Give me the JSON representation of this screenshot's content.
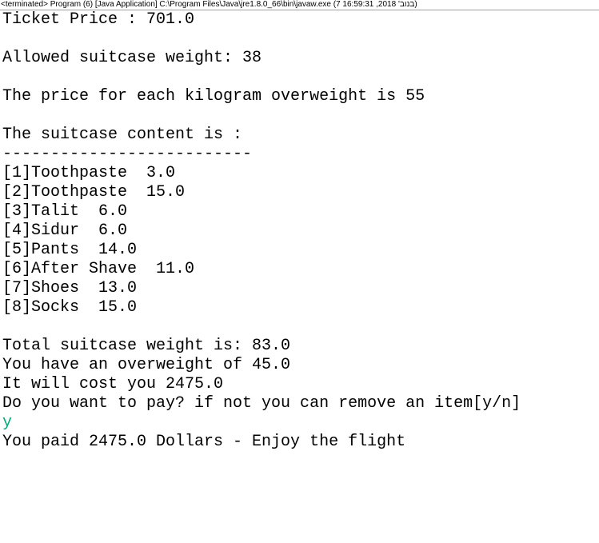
{
  "header": {
    "title": "<terminated> Program (6) [Java Application] C:\\Program Files\\Java\\jre1.8.0_66\\bin\\javaw.exe (7 16:59:31 ,2018 'בנוב)"
  },
  "colors": {
    "stdout": "#000000",
    "stdin": "#00a87a",
    "background": "#ffffff"
  },
  "console": {
    "lines": [
      {
        "text": "Ticket Price : 701.0",
        "kind": "output"
      },
      {
        "text": "",
        "kind": "output"
      },
      {
        "text": "Allowed suitcase weight: 38",
        "kind": "output"
      },
      {
        "text": "",
        "kind": "output"
      },
      {
        "text": "The price for each kilogram overweight is 55",
        "kind": "output"
      },
      {
        "text": "",
        "kind": "output"
      },
      {
        "text": "The suitcase content is :",
        "kind": "output"
      },
      {
        "text": "--------------------------",
        "kind": "output"
      },
      {
        "text": "[1]Toothpaste  3.0",
        "kind": "output"
      },
      {
        "text": "[2]Toothpaste  15.0",
        "kind": "output"
      },
      {
        "text": "[3]Talit  6.0",
        "kind": "output"
      },
      {
        "text": "[4]Sidur  6.0",
        "kind": "output"
      },
      {
        "text": "[5]Pants  14.0",
        "kind": "output"
      },
      {
        "text": "[6]After Shave  11.0",
        "kind": "output"
      },
      {
        "text": "[7]Shoes  13.0",
        "kind": "output"
      },
      {
        "text": "[8]Socks  15.0",
        "kind": "output"
      },
      {
        "text": "",
        "kind": "output"
      },
      {
        "text": "Total suitcase weight is: 83.0",
        "kind": "output"
      },
      {
        "text": "You have an overweight of 45.0",
        "kind": "output"
      },
      {
        "text": "It will cost you 2475.0",
        "kind": "output"
      },
      {
        "text": "Do you want to pay? if not you can remove an item[y/n]",
        "kind": "output"
      },
      {
        "text": "y",
        "kind": "input"
      },
      {
        "text": "You paid 2475.0 Dollars - Enjoy the flight",
        "kind": "output"
      }
    ]
  }
}
